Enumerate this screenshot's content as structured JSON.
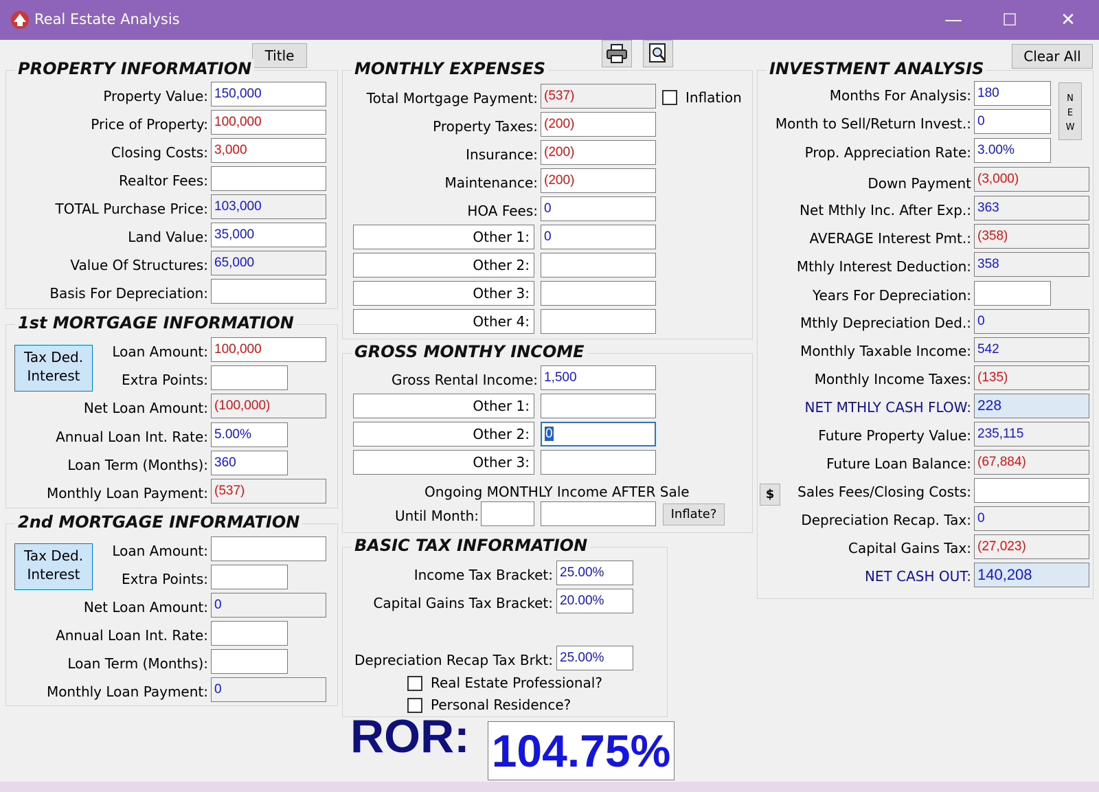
{
  "window": {
    "title": "Real Estate Analysis",
    "minimize": "—",
    "maximize": "☐",
    "close": "✕"
  },
  "toolbar": {
    "title_button": "Title",
    "clear_all_button": "Clear All",
    "print_icon": "printer-icon",
    "preview_icon": "print-preview-icon"
  },
  "property": {
    "title": "PROPERTY INFORMATION",
    "property_value_label": "Property Value:",
    "property_value": "150,000",
    "price_label": "Price of Property:",
    "price": "100,000",
    "closing_costs_label": "Closing Costs:",
    "closing_costs": "3,000",
    "realtor_fees_label": "Realtor Fees:",
    "realtor_fees": "",
    "total_price_label": "TOTAL Purchase Price:",
    "total_price": "103,000",
    "land_value_label": "Land Value:",
    "land_value": "35,000",
    "structures_label": "Value Of Structures:",
    "structures": "65,000",
    "basis_label": "Basis For Depreciation:",
    "basis": ""
  },
  "mortgage1": {
    "title": "1st MORTGAGE INFORMATION",
    "tax_button_line1": "Tax Ded.",
    "tax_button_line2": "Interest",
    "loan_amount_label": "Loan Amount:",
    "loan_amount": "100,000",
    "extra_points_label": "Extra Points:",
    "extra_points": "",
    "net_loan_label": "Net Loan Amount:",
    "net_loan": "(100,000)",
    "rate_label": "Annual Loan Int. Rate:",
    "rate": "5.00%",
    "term_label": "Loan Term (Months):",
    "term": "360",
    "payment_label": "Monthly Loan Payment:",
    "payment": "(537)"
  },
  "mortgage2": {
    "title": "2nd MORTGAGE INFORMATION",
    "tax_button_line1": "Tax Ded.",
    "tax_button_line2": "Interest",
    "loan_amount_label": "Loan Amount:",
    "loan_amount": "",
    "extra_points_label": "Extra Points:",
    "extra_points": "",
    "net_loan_label": "Net Loan Amount:",
    "net_loan": "0",
    "rate_label": "Annual Loan Int. Rate:",
    "rate": "",
    "term_label": "Loan Term (Months):",
    "term": "",
    "payment_label": "Monthly Loan Payment:",
    "payment": "0"
  },
  "expenses": {
    "title": "MONTHLY EXPENSES",
    "mortgage_label": "Total Mortgage Payment:",
    "mortgage": "(537)",
    "inflation_label": "Inflation",
    "taxes_label": "Property Taxes:",
    "taxes": "(200)",
    "insurance_label": "Insurance:",
    "insurance": "(200)",
    "maintenance_label": "Maintenance:",
    "maintenance": "(200)",
    "hoa_label": "HOA Fees:",
    "hoa": "0",
    "other1_label": "Other 1:",
    "other1": "0",
    "other2_label": "Other 2:",
    "other2": "",
    "other3_label": "Other 3:",
    "other3": "",
    "other4_label": "Other 4:",
    "other4": ""
  },
  "income": {
    "title": "GROSS MONTHY INCOME",
    "rental_label": "Gross Rental Income:",
    "rental": "1,500",
    "other1_label": "Other 1:",
    "other1": "",
    "other2_label": "Other 2:",
    "other2": "0",
    "other3_label": "Other 3:",
    "other3": "",
    "ongoing_label": "Ongoing MONTHLY Income AFTER Sale",
    "until_label": "Until Month:",
    "until_month": "",
    "ongoing_amount": "",
    "inflate_button": "Inflate?"
  },
  "tax": {
    "title": "BASIC TAX INFORMATION",
    "income_bracket_label": "Income Tax Bracket:",
    "income_bracket": "25.00%",
    "cg_bracket_label": "Capital Gains Tax Bracket:",
    "cg_bracket": "20.00%",
    "recap_label": "Depreciation Recap Tax Brkt:",
    "recap": "25.00%",
    "professional_label": "Real Estate Professional?",
    "residence_label": "Personal Residence?"
  },
  "investment": {
    "title": "INVESTMENT ANALYSIS",
    "new_button": "N E W",
    "months_label": "Months For Analysis:",
    "months": "180",
    "sell_month_label": "Month to Sell/Return Invest.:",
    "sell_month": "0",
    "appreciation_label": "Prop. Appreciation Rate:",
    "appreciation": "3.00%",
    "down_payment_label": "Down Payment",
    "down_payment": "(3,000)",
    "net_income_label": "Net Mthly Inc. After Exp.:",
    "net_income": "363",
    "avg_interest_label": "AVERAGE Interest Pmt.:",
    "avg_interest": "(358)",
    "interest_deduction_label": "Mthly Interest Deduction:",
    "interest_deduction": "358",
    "years_depr_label": "Years For Depreciation:",
    "years_depr": "",
    "depr_ded_label": "Mthly Depreciation Ded.:",
    "depr_ded": "0",
    "taxable_label": "Monthly Taxable Income:",
    "taxable": "542",
    "income_taxes_label": "Monthly Income Taxes:",
    "income_taxes": "(135)",
    "cash_flow_label": "NET MTHLY CASH FLOW:",
    "cash_flow": "228",
    "future_value_label": "Future Property Value:",
    "future_value": "235,115",
    "future_loan_label": "Future Loan Balance:",
    "future_loan": "(67,884)",
    "dollar_button": "$",
    "sales_fees_label": "Sales Fees/Closing Costs:",
    "sales_fees": "",
    "recap_tax_label": "Depreciation Recap. Tax:",
    "recap_tax": "0",
    "cg_tax_label": "Capital Gains Tax:",
    "cg_tax": "(27,023)",
    "cash_out_label": "NET CASH OUT:",
    "cash_out": "140,208"
  },
  "ror": {
    "label": "ROR:",
    "value": "104.75%"
  }
}
